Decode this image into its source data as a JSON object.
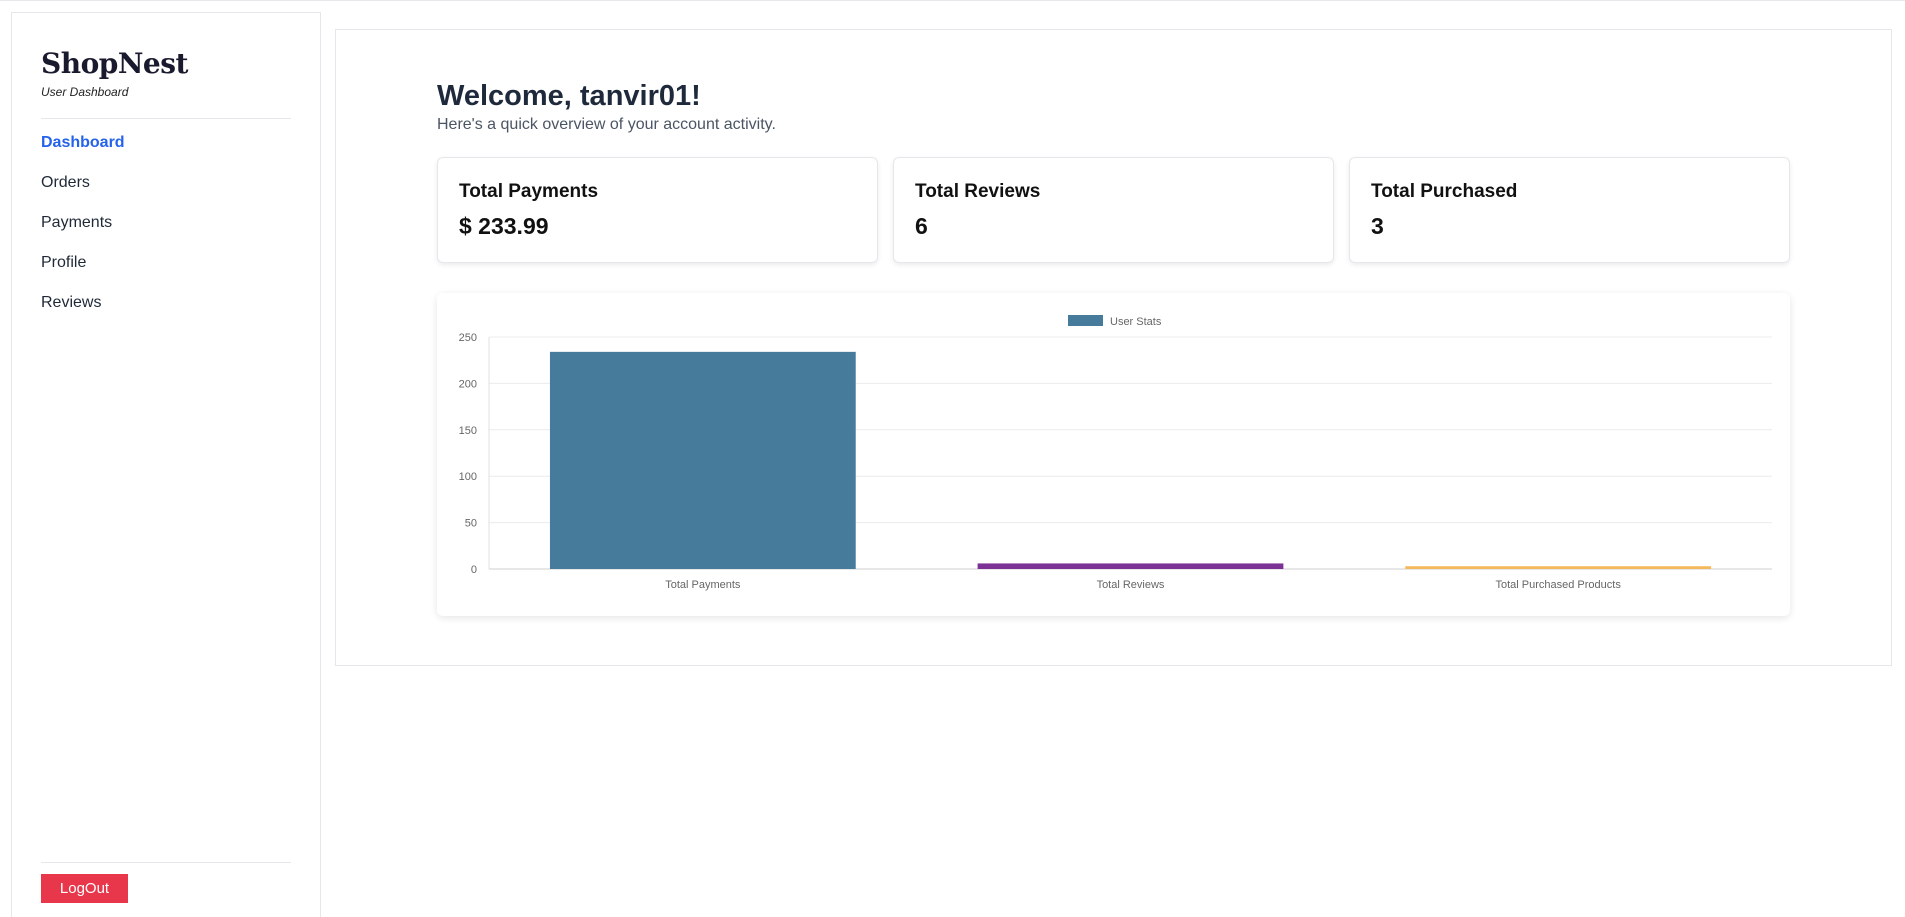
{
  "sidebar": {
    "brand": "ShopNest",
    "brand_subtitle": "User Dashboard",
    "items": [
      {
        "label": "Dashboard",
        "active": true
      },
      {
        "label": "Orders",
        "active": false
      },
      {
        "label": "Payments",
        "active": false
      },
      {
        "label": "Profile",
        "active": false
      },
      {
        "label": "Reviews",
        "active": false
      }
    ],
    "logout_label": "LogOut"
  },
  "main": {
    "welcome": "Welcome, tanvir01!",
    "subtitle": "Here's a quick overview of your account activity.",
    "cards": [
      {
        "label": "Total Payments",
        "value": "$ 233.99"
      },
      {
        "label": "Total Reviews",
        "value": "6"
      },
      {
        "label": "Total Purchased",
        "value": "3"
      }
    ]
  },
  "colors": {
    "accent": "#2563eb",
    "logout": "#e8374a",
    "bar_payments": "#467b9c",
    "bar_reviews": "#7b3294",
    "bar_purchased": "#f5b85a"
  },
  "chart_data": {
    "type": "bar",
    "categories": [
      "Total Payments",
      "Total Reviews",
      "Total Purchased Products"
    ],
    "series": [
      {
        "name": "User Stats",
        "values": [
          233.99,
          6,
          3
        ]
      }
    ],
    "bar_colors": [
      "#467b9c",
      "#7b3294",
      "#f5b85a"
    ],
    "ylim": [
      0,
      250
    ],
    "yticks": [
      0,
      50,
      100,
      150,
      200,
      250
    ],
    "grid": true,
    "legend": "top-center"
  }
}
